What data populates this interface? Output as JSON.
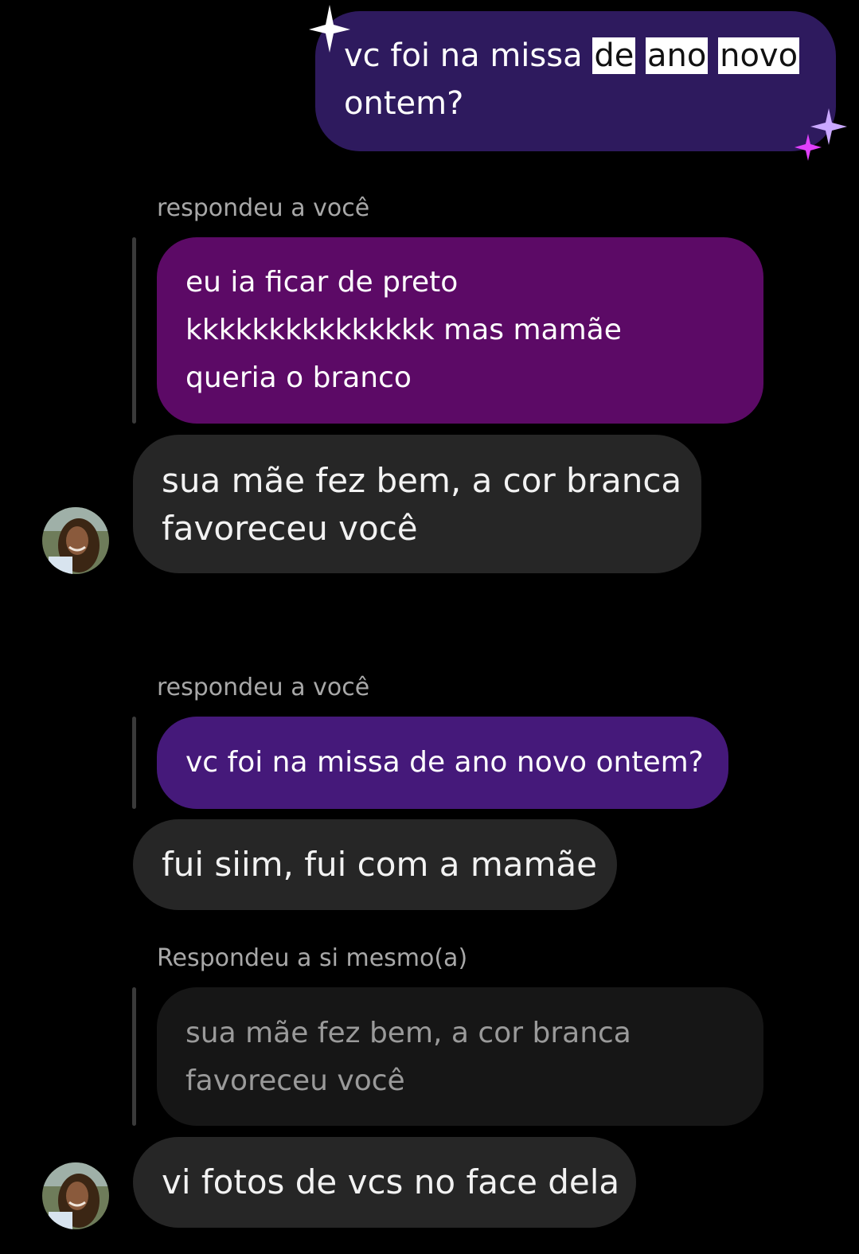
{
  "sent_message": {
    "line1_parts": [
      "vc foi na missa ",
      "de",
      " ",
      "ano",
      " ",
      "novo"
    ],
    "line2": "ontem?"
  },
  "thread1": {
    "reply_label": "respondeu a você",
    "quoted_lines": [
      "eu ia ficar de preto",
      "kkkkkkkkkkkkkkk mas mamãe",
      "queria o branco"
    ],
    "message_lines": [
      "sua mãe fez bem, a cor branca",
      "favoreceu você"
    ]
  },
  "thread2": {
    "reply_label": "respondeu a você",
    "quoted_line": "vc foi na missa de ano novo ontem?",
    "message": "fui siim, fui com a mamãe"
  },
  "thread3": {
    "reply_label": "Respondeu a si mesmo(a)",
    "quoted_lines": [
      "sua mãe fez bem, a cor branca",
      "favoreceu você"
    ],
    "message": "vi fotos de vcs no face dela"
  },
  "colors": {
    "sent_bubble": "#2e1a5e",
    "quote_purple": "#5c0a66",
    "quote_violet": "#45197a",
    "received_bubble": "#262626",
    "self_quote": "#161616"
  },
  "icons": [
    "sparkle-icon",
    "avatar"
  ]
}
